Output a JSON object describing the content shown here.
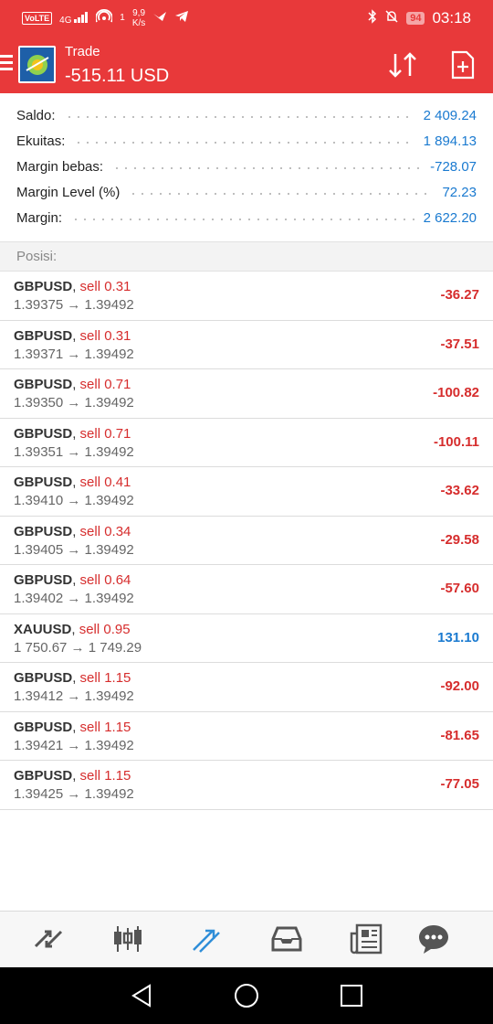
{
  "status_bar": {
    "volte": "VoLTE",
    "network": "4G",
    "hotspot_count": "1",
    "speed_value": "9,9",
    "speed_unit": "K/s",
    "battery": "94",
    "time": "03:18"
  },
  "header": {
    "title": "Trade",
    "amount": "-515.11 USD"
  },
  "summary": [
    {
      "label": "Saldo:",
      "value": "2 409.24"
    },
    {
      "label": "Ekuitas:",
      "value": "1 894.13"
    },
    {
      "label": "Margin bebas:",
      "value": "-728.07"
    },
    {
      "label": "Margin Level (%)",
      "value": "72.23"
    },
    {
      "label": "Margin:",
      "value": "2 622.20"
    }
  ],
  "positions_header": "Posisi:",
  "positions": [
    {
      "symbol": "GBPUSD",
      "type": "sell 0.31",
      "prices": "1.39375 → 1.39492",
      "profit": "-36.27",
      "sign": "neg"
    },
    {
      "symbol": "GBPUSD",
      "type": "sell 0.31",
      "prices": "1.39371 → 1.39492",
      "profit": "-37.51",
      "sign": "neg"
    },
    {
      "symbol": "GBPUSD",
      "type": "sell 0.71",
      "prices": "1.39350 → 1.39492",
      "profit": "-100.82",
      "sign": "neg"
    },
    {
      "symbol": "GBPUSD",
      "type": "sell 0.71",
      "prices": "1.39351 → 1.39492",
      "profit": "-100.11",
      "sign": "neg"
    },
    {
      "symbol": "GBPUSD",
      "type": "sell 0.41",
      "prices": "1.39410 → 1.39492",
      "profit": "-33.62",
      "sign": "neg"
    },
    {
      "symbol": "GBPUSD",
      "type": "sell 0.34",
      "prices": "1.39405 → 1.39492",
      "profit": "-29.58",
      "sign": "neg"
    },
    {
      "symbol": "GBPUSD",
      "type": "sell 0.64",
      "prices": "1.39402 → 1.39492",
      "profit": "-57.60",
      "sign": "neg"
    },
    {
      "symbol": "XAUUSD",
      "type": "sell 0.95",
      "prices": "1 750.67 → 1 749.29",
      "profit": "131.10",
      "sign": "pos"
    },
    {
      "symbol": "GBPUSD",
      "type": "sell 1.15",
      "prices": "1.39412 → 1.39492",
      "profit": "-92.00",
      "sign": "neg"
    },
    {
      "symbol": "GBPUSD",
      "type": "sell 1.15",
      "prices": "1.39421 → 1.39492",
      "profit": "-81.65",
      "sign": "neg"
    },
    {
      "symbol": "GBPUSD",
      "type": "sell 1.15",
      "prices": "1.39425 → 1.39492",
      "profit": "-77.05",
      "sign": "neg"
    }
  ],
  "bottom_nav": [
    {
      "icon": "quotes-icon"
    },
    {
      "icon": "chart-icon"
    },
    {
      "icon": "trade-icon",
      "active": true
    },
    {
      "icon": "history-icon"
    },
    {
      "icon": "news-icon"
    },
    {
      "icon": "messages-icon"
    }
  ],
  "colors": {
    "header_bg": "#e8393a",
    "positive": "#1a7ad0",
    "negative": "#d62d2d",
    "nav_active": "#2f8ed8",
    "nav_inactive": "#555555"
  }
}
